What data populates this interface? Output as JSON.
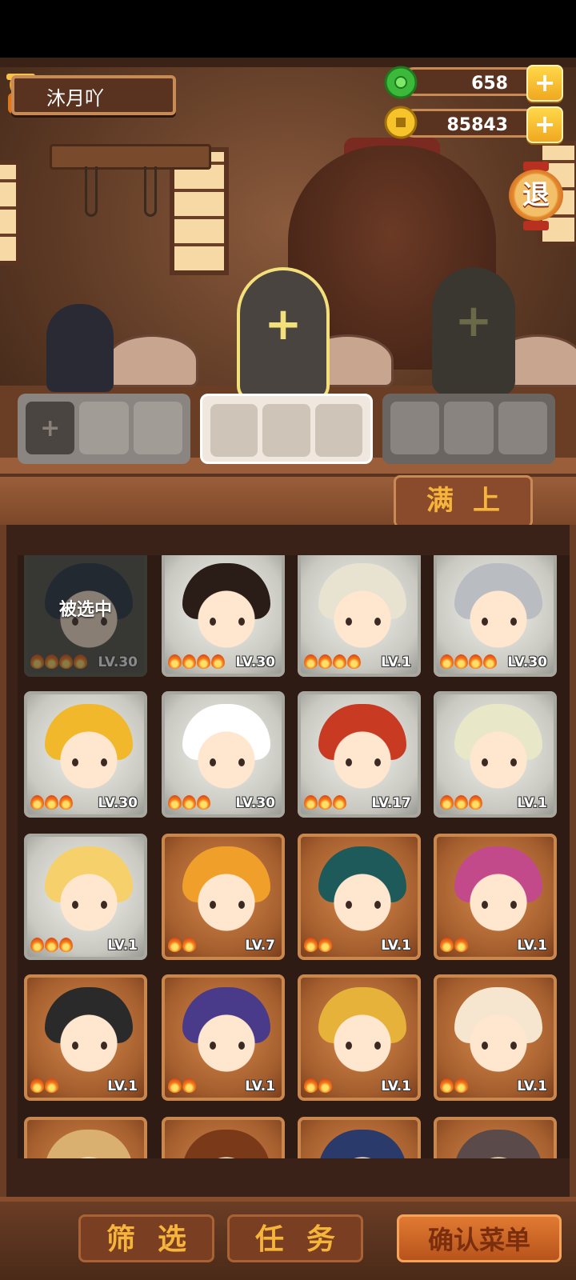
{
  "player": {
    "name": "沐月吖"
  },
  "currencies": [
    {
      "name": "jade",
      "value": "658",
      "icon": "green-jade-icon"
    },
    {
      "name": "coins",
      "value": "85843",
      "icon": "gold-coin-icon"
    }
  ],
  "exit_label": "退",
  "slot_plus": "+",
  "fill_label": "满上",
  "characters": [
    {
      "level": "LV.30",
      "flames": 4,
      "card": "dark",
      "selected": true,
      "hair": "#1e2a3a"
    },
    {
      "level": "LV.30",
      "flames": 4,
      "card": "gray",
      "selected": false,
      "hair": "#2a1c16"
    },
    {
      "level": "LV.1",
      "flames": 4,
      "card": "gray",
      "selected": false,
      "hair": "#e8e2d0"
    },
    {
      "level": "LV.30",
      "flames": 4,
      "card": "gray",
      "selected": false,
      "hair": "#b9bcc0"
    },
    {
      "level": "LV.30",
      "flames": 3,
      "card": "gray",
      "selected": false,
      "hair": "#f0b82a"
    },
    {
      "level": "LV.30",
      "flames": 3,
      "card": "gray",
      "selected": false,
      "hair": "#ffffff"
    },
    {
      "level": "LV.17",
      "flames": 3,
      "card": "gray",
      "selected": false,
      "hair": "#c83a22"
    },
    {
      "level": "LV.1",
      "flames": 3,
      "card": "gray",
      "selected": false,
      "hair": "#e8e8c8"
    },
    {
      "level": "LV.1",
      "flames": 3,
      "card": "gray",
      "selected": false,
      "hair": "#f6d06a"
    },
    {
      "level": "LV.7",
      "flames": 2,
      "card": "brown",
      "selected": false,
      "hair": "#f0a02a"
    },
    {
      "level": "LV.1",
      "flames": 2,
      "card": "brown",
      "selected": false,
      "hair": "#1f5a5a"
    },
    {
      "level": "LV.1",
      "flames": 2,
      "card": "brown",
      "selected": false,
      "hair": "#c24a8a"
    },
    {
      "level": "LV.1",
      "flames": 2,
      "card": "brown",
      "selected": false,
      "hair": "#2a2a2a"
    },
    {
      "level": "LV.1",
      "flames": 2,
      "card": "brown",
      "selected": false,
      "hair": "#4a3a8a"
    },
    {
      "level": "LV.1",
      "flames": 2,
      "card": "brown",
      "selected": false,
      "hair": "#e6b23a"
    },
    {
      "level": "LV.1",
      "flames": 2,
      "card": "brown",
      "selected": false,
      "hair": "#f6e6cf"
    },
    {
      "level": "",
      "flames": 0,
      "card": "brown",
      "selected": false,
      "hair": "#d9b070"
    },
    {
      "level": "",
      "flames": 0,
      "card": "brown",
      "selected": false,
      "hair": "#7a3a1a"
    },
    {
      "level": "",
      "flames": 0,
      "card": "brown",
      "selected": false,
      "hair": "#2a3a6a"
    },
    {
      "level": "",
      "flames": 0,
      "card": "brown",
      "selected": false,
      "hair": "#5a4a4a"
    }
  ],
  "selected_label": "被选中",
  "bottom_buttons": {
    "filter": "筛选",
    "task": "任务",
    "confirm": "确认菜单"
  },
  "colors": {
    "accent": "#f6b53a",
    "wood": "#6a3d25"
  }
}
